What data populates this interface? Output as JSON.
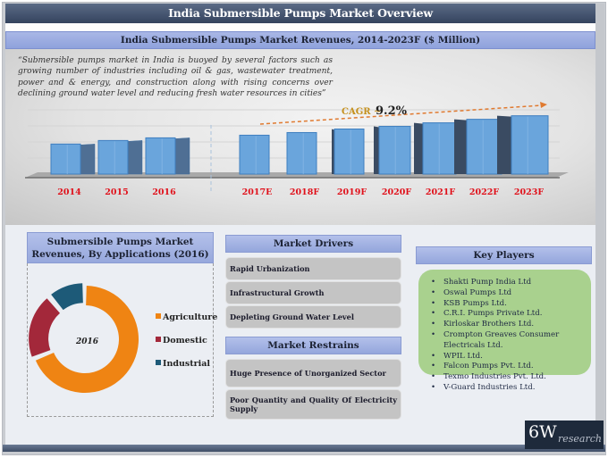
{
  "header": {
    "title": "India Submersible Pumps Market Overview",
    "subtitle": "India Submersible Pumps Market Revenues, 2014-2023F ($ Million)"
  },
  "quote": "“Submersible pumps market in India is buoyed by several factors such as growing number of industries including oil & gas, wastewater treatment, power and & energy, and construction along with rising concerns over declining ground water level and reducing fresh water resources in cities”",
  "chart_data": [
    {
      "type": "bar",
      "title": "India Submersible Pumps Market Revenues, 2014-2023F ($ Million)",
      "xlabel": "",
      "ylabel": "",
      "categories": [
        "2014",
        "2015",
        "2016",
        "2017E",
        "2018F",
        "2019F",
        "2020F",
        "2021F",
        "2022F",
        "2023F"
      ],
      "values": [
        34,
        38,
        41,
        44,
        47,
        51,
        54,
        58,
        62,
        66
      ],
      "values_note": "relative bar heights (no axis values shown)",
      "ylim": [
        0,
        80
      ],
      "grid": true,
      "annotation": {
        "label": "CAGR ~ ",
        "value": "9.2%"
      },
      "colors": {
        "bar": "#5b9bd5",
        "tick_label": "#e0101a",
        "cagr_label": "#c5901d",
        "arrow": "#e07a30"
      }
    },
    {
      "type": "pie",
      "title": "Submersible Pumps Market Revenues, By Applications (2016)",
      "center_label": "2016",
      "categories": [
        "Agriculture",
        "Domestic",
        "Industrial"
      ],
      "values": [
        69,
        20,
        11
      ],
      "colors": [
        "#ef8413",
        "#a3283a",
        "#1d5a78"
      ],
      "legend": "right"
    }
  ],
  "drivers": {
    "title": "Market Drivers",
    "items": [
      "Rapid Urbanization",
      "Infrastructural Growth",
      "Depleting Ground Water Level"
    ]
  },
  "restrains": {
    "title": "Market Restrains",
    "items": [
      "Huge Presence of Unorganized Sector",
      "Poor Quantity and Quality Of Electricity Supply"
    ]
  },
  "key_players": {
    "title": "Key Players",
    "items": [
      "Shakti Pump India Ltd",
      "Oswal Pumps Ltd",
      "KSB Pumps Ltd.",
      "C.R.I. Pumps Private Ltd.",
      "Kirloskar Brothers Ltd.",
      "Crompton Greaves Consumer Electricals Ltd.",
      "WPIL Ltd.",
      "Falcon Pumps Pvt. Ltd.",
      "Texmo Industries Pvt. Ltd.",
      "V-Guard Industries Ltd."
    ]
  },
  "logo": {
    "main": "6W",
    "sub": "research"
  }
}
